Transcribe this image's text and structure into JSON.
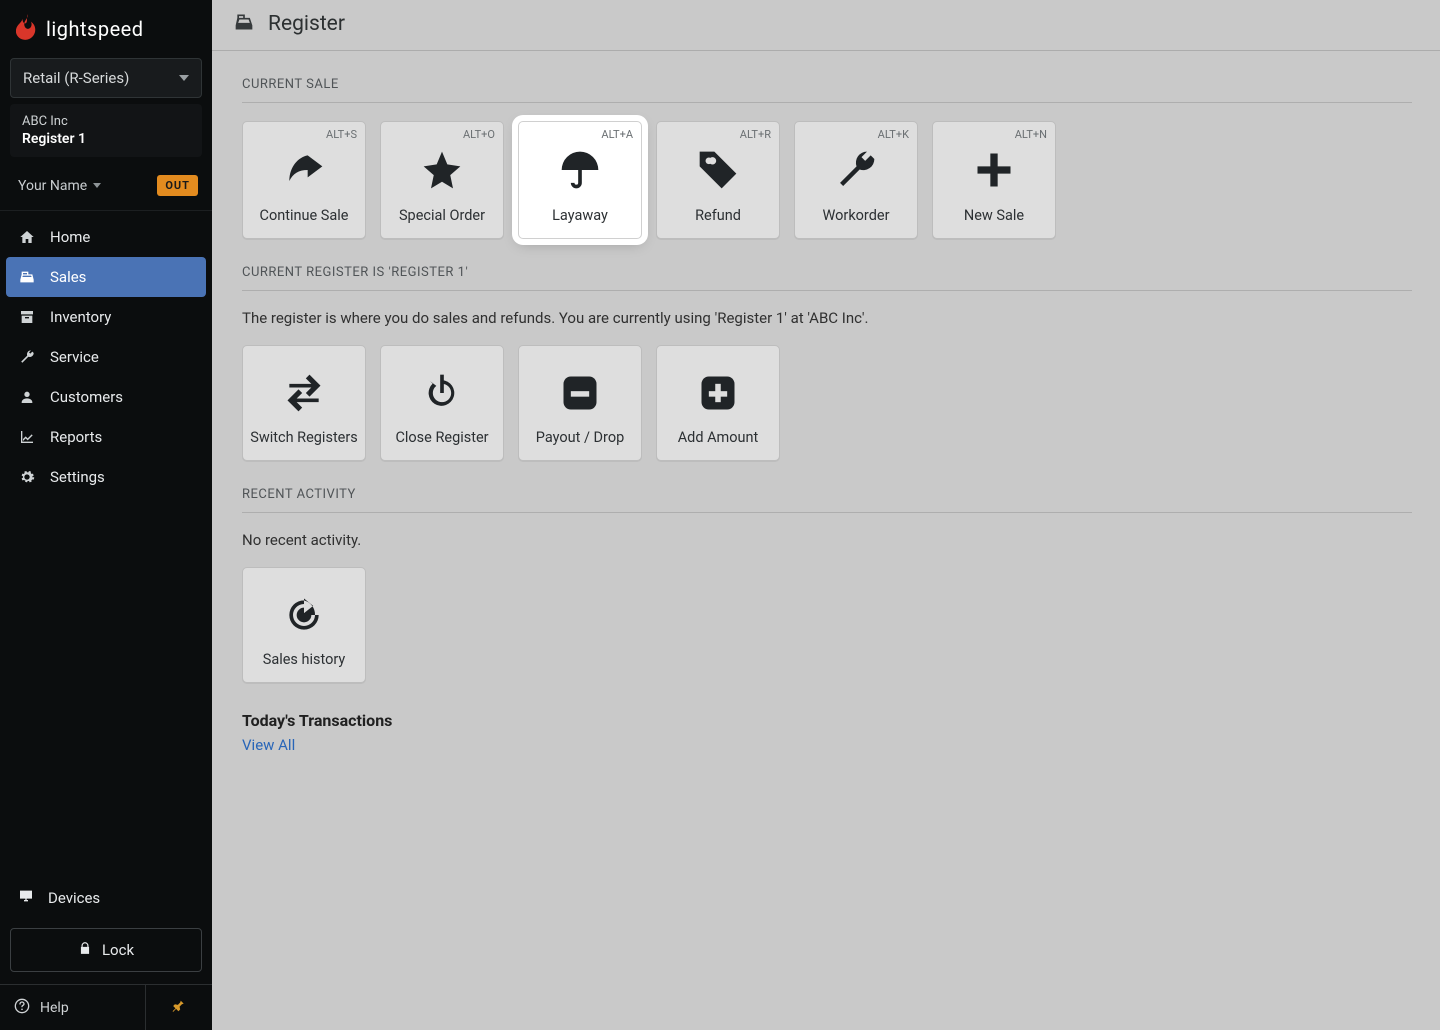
{
  "brand": {
    "name": "lightspeed"
  },
  "product_selector": {
    "label": "Retail (R-Series)"
  },
  "org": {
    "company": "ABC Inc",
    "register": "Register 1"
  },
  "user": {
    "name": "Your Name",
    "status_badge": "OUT"
  },
  "nav": {
    "items": [
      {
        "label": "Home"
      },
      {
        "label": "Sales"
      },
      {
        "label": "Inventory"
      },
      {
        "label": "Service"
      },
      {
        "label": "Customers"
      },
      {
        "label": "Reports"
      },
      {
        "label": "Settings"
      }
    ],
    "devices": "Devices",
    "lock": "Lock",
    "help": "Help"
  },
  "page": {
    "title": "Register",
    "sections": {
      "current_sale": {
        "heading": "CURRENT SALE",
        "tiles": [
          {
            "label": "Continue Sale",
            "shortcut": "ALT+S"
          },
          {
            "label": "Special Order",
            "shortcut": "ALT+O"
          },
          {
            "label": "Layaway",
            "shortcut": "ALT+A"
          },
          {
            "label": "Refund",
            "shortcut": "ALT+R"
          },
          {
            "label": "Workorder",
            "shortcut": "ALT+K"
          },
          {
            "label": "New Sale",
            "shortcut": "ALT+N"
          }
        ]
      },
      "current_register": {
        "heading": "CURRENT REGISTER IS 'REGISTER 1'",
        "desc": "The register is where you do sales and refunds. You are currently using 'Register 1'  at 'ABC Inc'.",
        "tiles": [
          {
            "label": "Switch Registers"
          },
          {
            "label": "Close Register"
          },
          {
            "label": "Payout / Drop"
          },
          {
            "label": "Add Amount"
          }
        ]
      },
      "recent": {
        "heading": "RECENT ACTIVITY",
        "empty": "No recent activity.",
        "tiles": [
          {
            "label": "Sales history"
          }
        ],
        "todays_label": "Today's Transactions",
        "view_all": "View All"
      }
    }
  }
}
